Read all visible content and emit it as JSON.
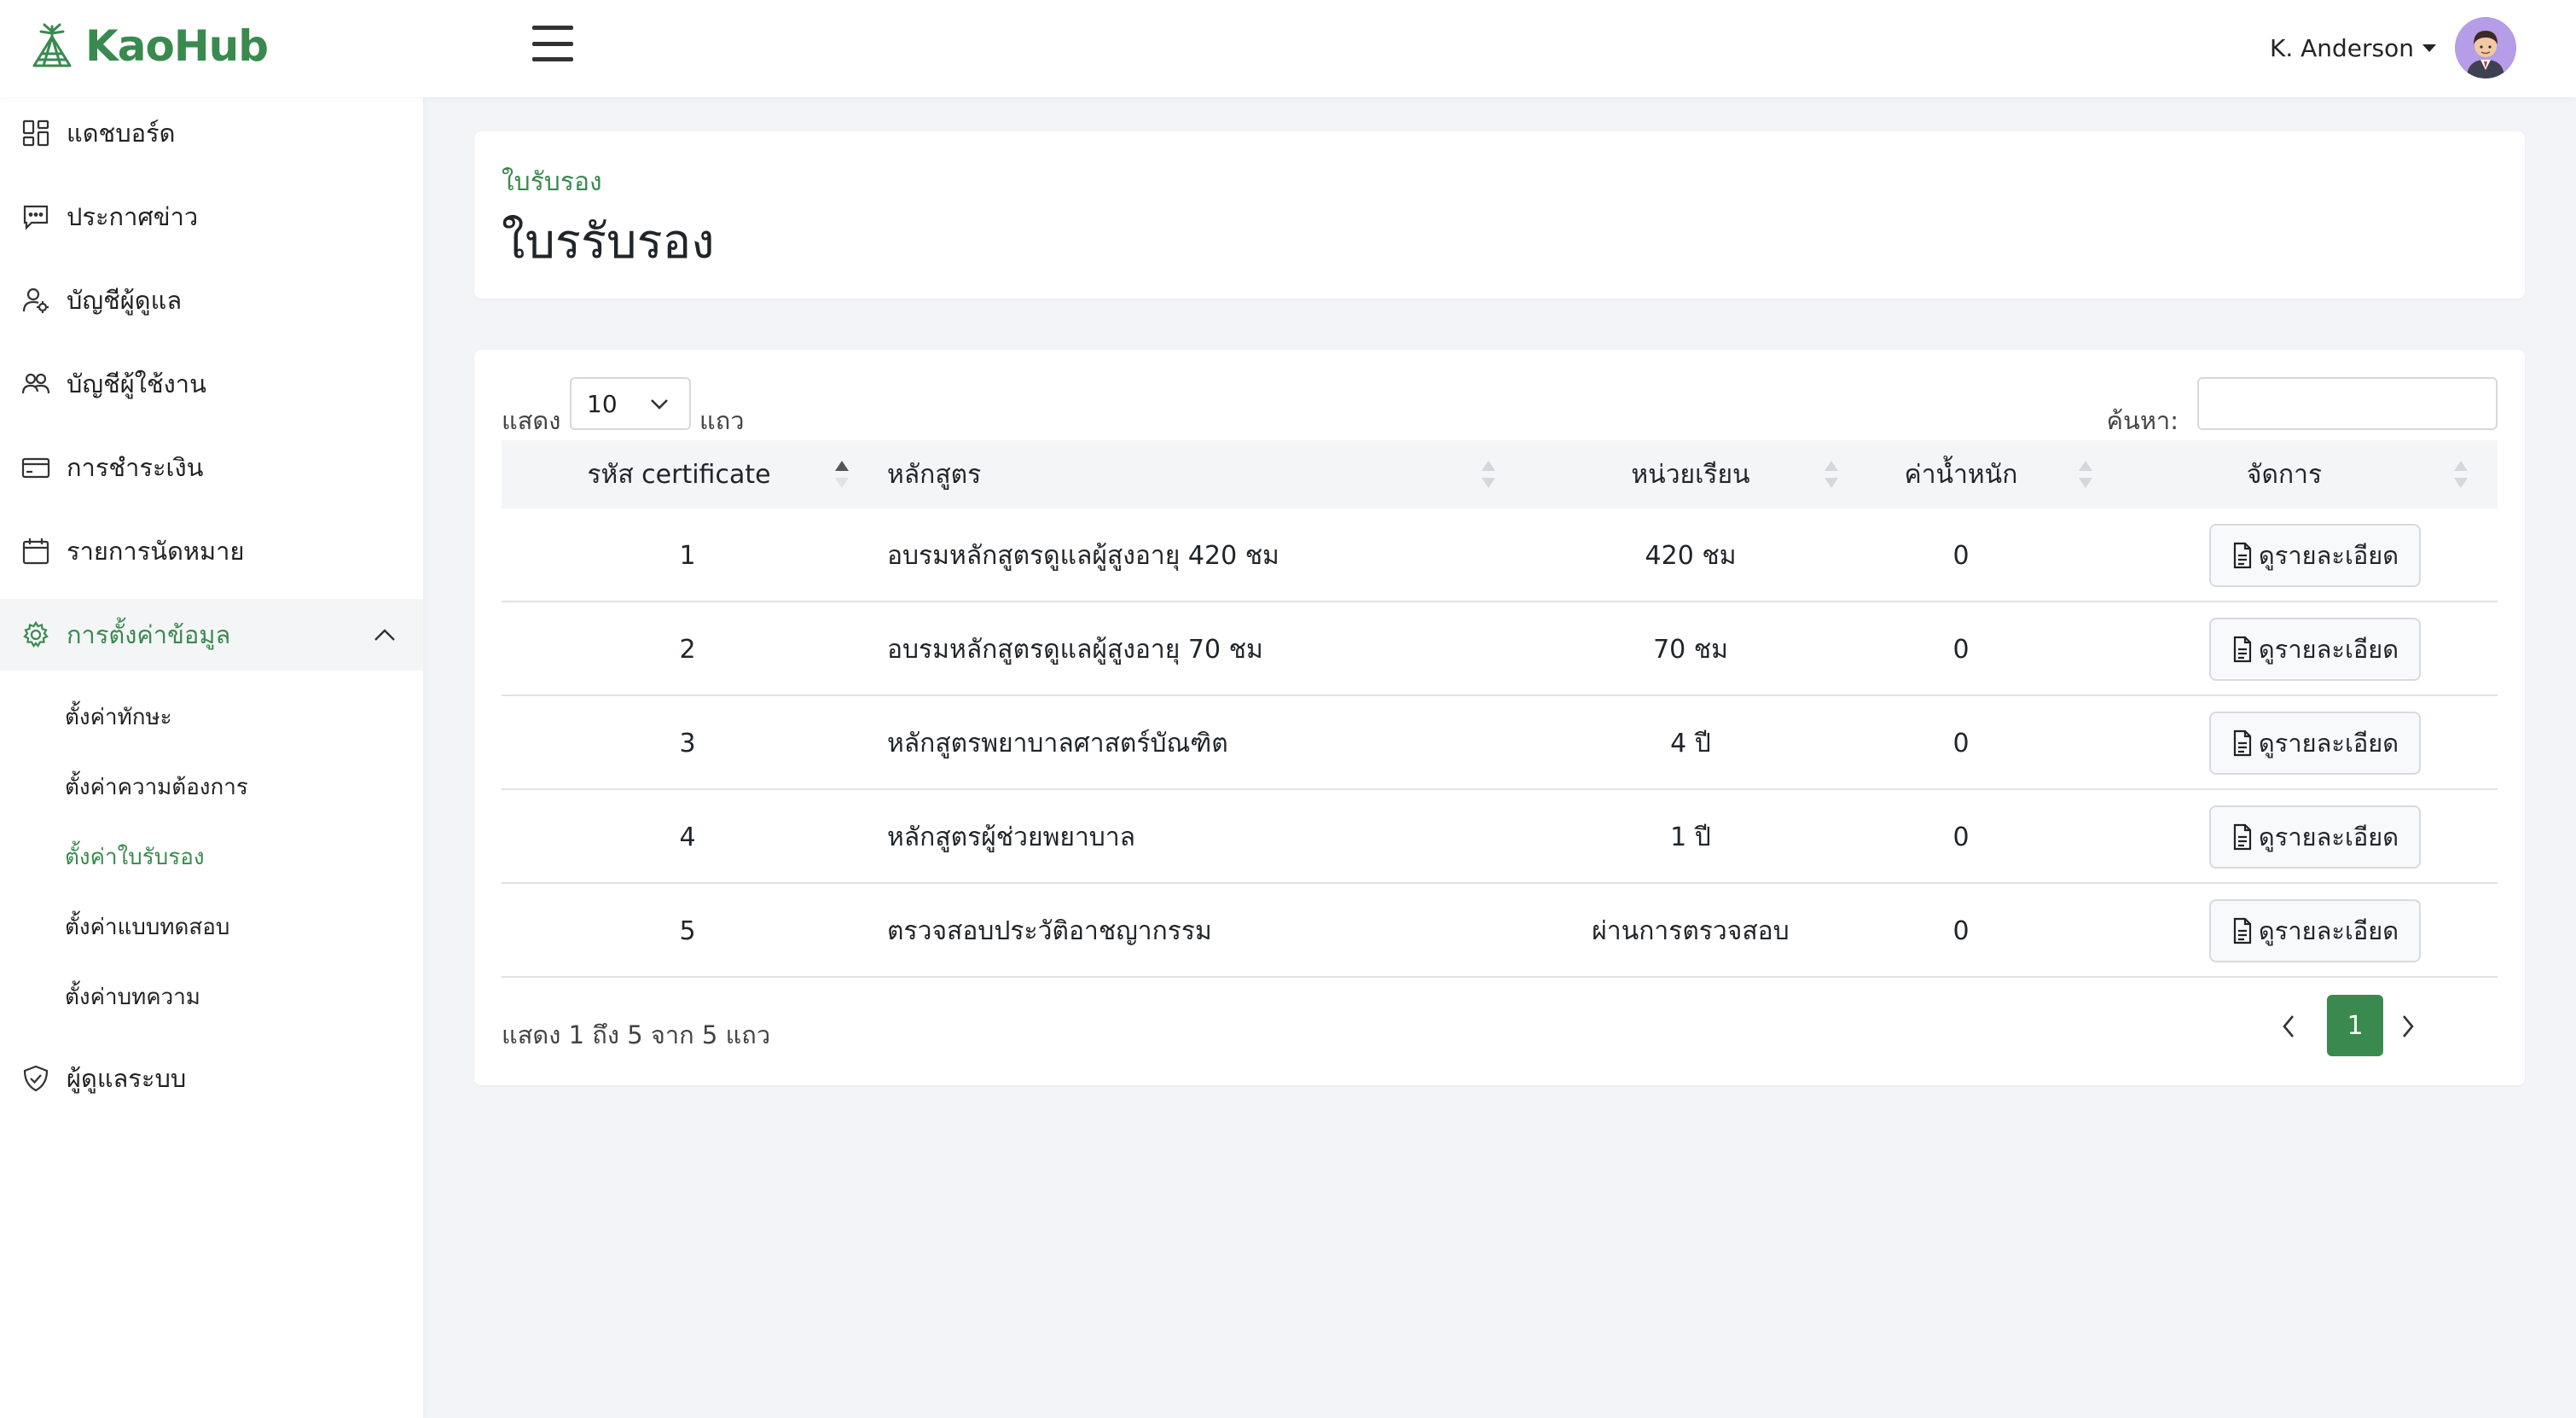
{
  "app": {
    "name": "KaoHub",
    "brand_color": "#3a8a4f"
  },
  "user": {
    "name": "K. Anderson"
  },
  "sidebar": {
    "items": [
      {
        "label": "แดชบอร์ด",
        "icon": "dashboard-icon"
      },
      {
        "label": "ประกาศข่าว",
        "icon": "chat-icon"
      },
      {
        "label": "บัญชีผู้ดูแล",
        "icon": "user-gear-icon"
      },
      {
        "label": "บัญชีผู้ใช้งาน",
        "icon": "users-icon"
      },
      {
        "label": "การชำระเงิน",
        "icon": "credit-card-icon"
      },
      {
        "label": "รายการนัดหมาย",
        "icon": "calendar-icon"
      },
      {
        "label": "การตั้งค่าข้อมูล",
        "icon": "gear-icon",
        "expanded": true
      },
      {
        "label": "ผู้ดูแลระบบ",
        "icon": "shield-icon"
      }
    ],
    "sub_items": [
      {
        "label": "ตั้งค่าทักษะ"
      },
      {
        "label": "ตั้งค่าความต้องการ"
      },
      {
        "label": "ตั้งค่าใบรับรอง",
        "current": true
      },
      {
        "label": "ตั้งค่าแบบทดสอบ"
      },
      {
        "label": "ตั้งค่าบทความ"
      }
    ]
  },
  "header": {
    "breadcrumb": "ใบรับรอง",
    "title": "ใบรรับรอง"
  },
  "table_controls": {
    "show_label": "แสดง",
    "page_length": "10",
    "rows_label": "แถว",
    "search_label": "ค้นหา:",
    "search_value": ""
  },
  "table": {
    "columns": [
      "รหัส certificate",
      "หลักสูตร",
      "หน่วยเรียน",
      "ค่าน้ำหนัก",
      "จัดการ"
    ],
    "sorted_column": 0,
    "rows": [
      {
        "id": "1",
        "course": "อบรมหลักสูตรดูแลผู้สูงอายุ 420 ชม",
        "unit": "420 ชม",
        "weight": "0",
        "action": "ดูรายละเอียด"
      },
      {
        "id": "2",
        "course": "อบรมหลักสูตรดูแลผู้สูงอายุ 70 ชม",
        "unit": "70 ชม",
        "weight": "0",
        "action": "ดูรายละเอียด"
      },
      {
        "id": "3",
        "course": "หลักสูตรพยาบาลศาสตร์บัณฑิต",
        "unit": "4 ปี",
        "weight": "0",
        "action": "ดูรายละเอียด"
      },
      {
        "id": "4",
        "course": "หลักสูตรผู้ช่วยพยาบาล",
        "unit": "1 ปี",
        "weight": "0",
        "action": "ดูรายละเอียด"
      },
      {
        "id": "5",
        "course": "ตรวจสอบประวัติอาชญากรรม",
        "unit": "ผ่านการตรวจสอบ",
        "weight": "0",
        "action": "ดูรายละเอียด"
      }
    ]
  },
  "footer": {
    "info": "แสดง 1 ถึง 5 จาก 5 แถว",
    "current_page": "1"
  }
}
